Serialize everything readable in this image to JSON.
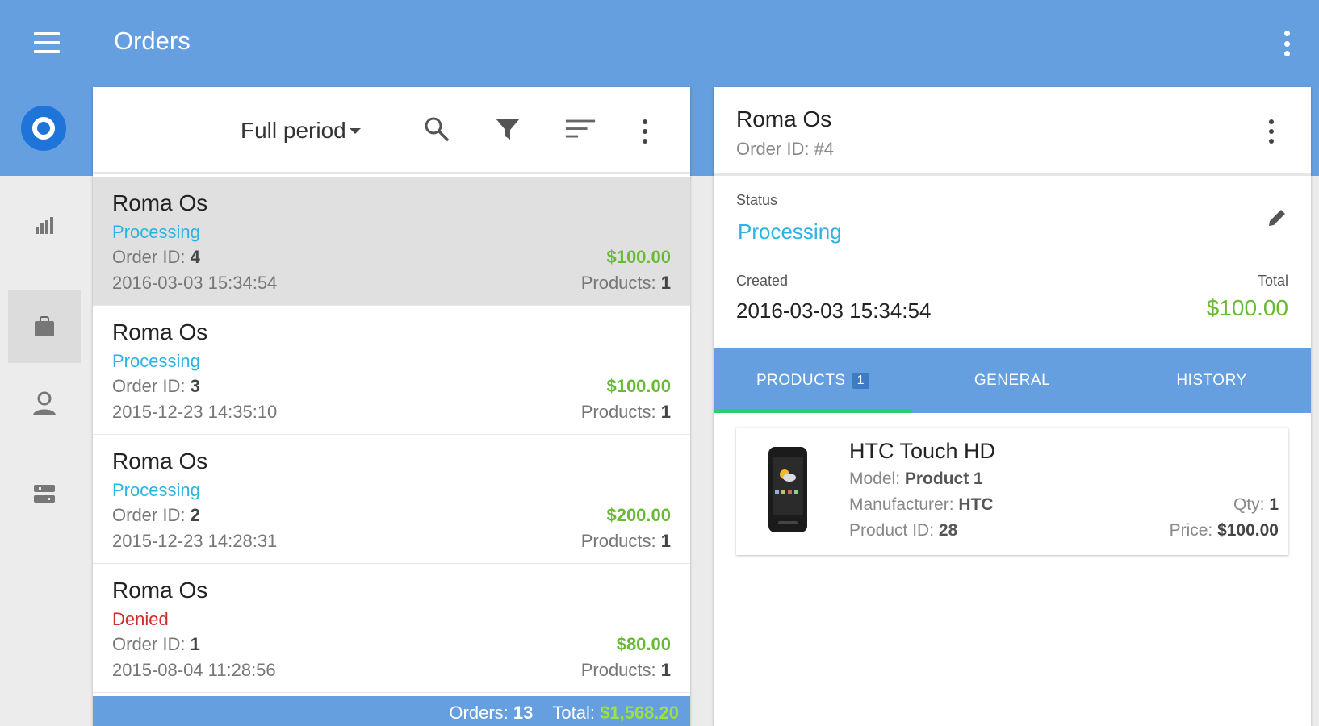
{
  "app": {
    "title": "Orders"
  },
  "colors": {
    "primary": "#659fdf",
    "accent_green": "#66bb33",
    "status_processing": "#2ab3e3",
    "status_denied": "#d12d2d",
    "tab_indicator": "#2ecc71"
  },
  "icons": {
    "appbar": [
      "menu-icon",
      "more-vert-icon"
    ],
    "rail": [
      "logo-icon",
      "chart-icon",
      "bag-icon",
      "person-icon",
      "network-icon"
    ],
    "toolbar": [
      "search-icon",
      "filter-icon",
      "sort-icon",
      "more-vert-icon"
    ],
    "detail": [
      "more-vert-icon",
      "edit-icon",
      "phone-image"
    ]
  },
  "toolbar": {
    "period": "Full period"
  },
  "orders": [
    {
      "customer": "Roma Os",
      "status": "Processing",
      "id_label": "Order ID: ",
      "id": "4",
      "date": "2016-03-03 15:34:54",
      "price": "$100.00",
      "products_label": "Products: ",
      "products": "1"
    },
    {
      "customer": "Roma Os",
      "status": "Processing",
      "id_label": "Order ID: ",
      "id": "3",
      "date": "2015-12-23 14:35:10",
      "price": "$100.00",
      "products_label": "Products: ",
      "products": "1"
    },
    {
      "customer": "Roma Os",
      "status": "Processing",
      "id_label": "Order ID: ",
      "id": "2",
      "date": "2015-12-23 14:28:31",
      "price": "$200.00",
      "products_label": "Products: ",
      "products": "1"
    },
    {
      "customer": "Roma Os",
      "status": "Denied",
      "id_label": "Order ID: ",
      "id": "1",
      "date": "2015-08-04 11:28:56",
      "price": "$80.00",
      "products_label": "Products: ",
      "products": "1"
    }
  ],
  "footer": {
    "orders_label": "Orders: ",
    "orders_count": "13",
    "total_label": "Total: ",
    "total_value": "$1,568.20"
  },
  "detail": {
    "customer": "Roma Os",
    "order_id": "Order ID: #4",
    "status_label": "Status",
    "status": "Processing",
    "created_label": "Created",
    "created": "2016-03-03 15:34:54",
    "total_label": "Total",
    "total": "$100.00",
    "tabs": [
      {
        "label": "PRODUCTS",
        "badge": "1"
      },
      {
        "label": "GENERAL"
      },
      {
        "label": "HISTORY"
      }
    ],
    "product": {
      "name": "HTC Touch HD",
      "model_label": "Model: ",
      "model": "Product 1",
      "manufacturer_label": "Manufacturer: ",
      "manufacturer": "HTC",
      "product_id_label": "Product ID: ",
      "product_id": "28",
      "qty_label": "Qty: ",
      "qty": "1",
      "price_label": "Price: ",
      "price": "$100.00"
    }
  }
}
